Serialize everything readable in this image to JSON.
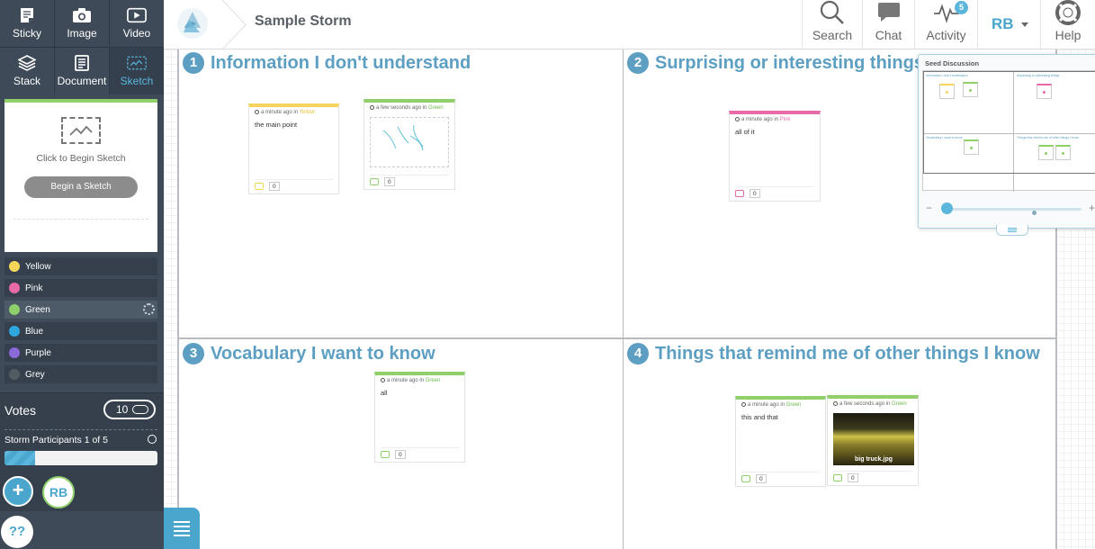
{
  "tools": [
    {
      "label": "Sticky",
      "icon": "sticky-icon"
    },
    {
      "label": "Image",
      "icon": "camera-icon"
    },
    {
      "label": "Video",
      "icon": "video-icon"
    },
    {
      "label": "Stack",
      "icon": "stack-icon"
    },
    {
      "label": "Document",
      "icon": "document-icon"
    },
    {
      "label": "Sketch",
      "icon": "sketch-icon",
      "active": true
    }
  ],
  "sketch_panel": {
    "hint": "Click to Begin Sketch",
    "button": "Begin a Sketch"
  },
  "colors": [
    {
      "label": "Yellow",
      "hex": "#f5d55a"
    },
    {
      "label": "Pink",
      "hex": "#e86aa9"
    },
    {
      "label": "Green",
      "hex": "#8fd06a",
      "selected": true
    },
    {
      "label": "Blue",
      "hex": "#2ea7e0"
    },
    {
      "label": "Purple",
      "hex": "#8a6ad8"
    },
    {
      "label": "Grey",
      "hex": "#555b63"
    }
  ],
  "votes": {
    "title": "Votes",
    "count": "10"
  },
  "participants": {
    "label": "Storm Participants 1 of 5",
    "progress": 0.2
  },
  "user": {
    "initials": "RB"
  },
  "help_short": "??",
  "header": {
    "title": "Sample Storm",
    "nav": {
      "search": "Search",
      "chat": "Chat",
      "activity": "Activity",
      "activity_badge": "5",
      "help": "Help"
    },
    "user_initials": "RB"
  },
  "quadrants": [
    {
      "num": "1",
      "title": "Information I don't understand"
    },
    {
      "num": "2",
      "title": "Surprising or interesting things"
    },
    {
      "num": "3",
      "title": "Vocabulary I want to know"
    },
    {
      "num": "4",
      "title": "Things that remind me of other things I know"
    }
  ],
  "cards": [
    {
      "meta_time": "a minute ago in",
      "meta_color": "Yellow",
      "body": "the main point",
      "comments": "0"
    },
    {
      "meta_time": "a few seconds ago in",
      "meta_color": "Green",
      "body": "",
      "comments": "0"
    },
    {
      "meta_time": "a minute ago in",
      "meta_color": "Pink",
      "body": "all of it",
      "comments": "0"
    },
    {
      "meta_time": "a minute ago in",
      "meta_color": "Green",
      "body": "all",
      "comments": "0"
    },
    {
      "meta_time": "a minute ago in",
      "meta_color": "Green",
      "body": "this and that",
      "comments": "0"
    },
    {
      "meta_time": "a few seconds ago in",
      "meta_color": "Green",
      "body": "",
      "image_caption": "big truck.jpg",
      "comments": "0"
    }
  ],
  "minimap": {
    "title": "Seed Discussion",
    "quadrants": [
      "Information I don't understand",
      "Surprising or interesting things",
      "Vocabulary I want to know",
      "Things that remind me of other things I know"
    ]
  },
  "accent_colors": {
    "primary": "#5bb6dc",
    "sidebar": "#3f4a58",
    "heading": "#5c9fc2"
  }
}
